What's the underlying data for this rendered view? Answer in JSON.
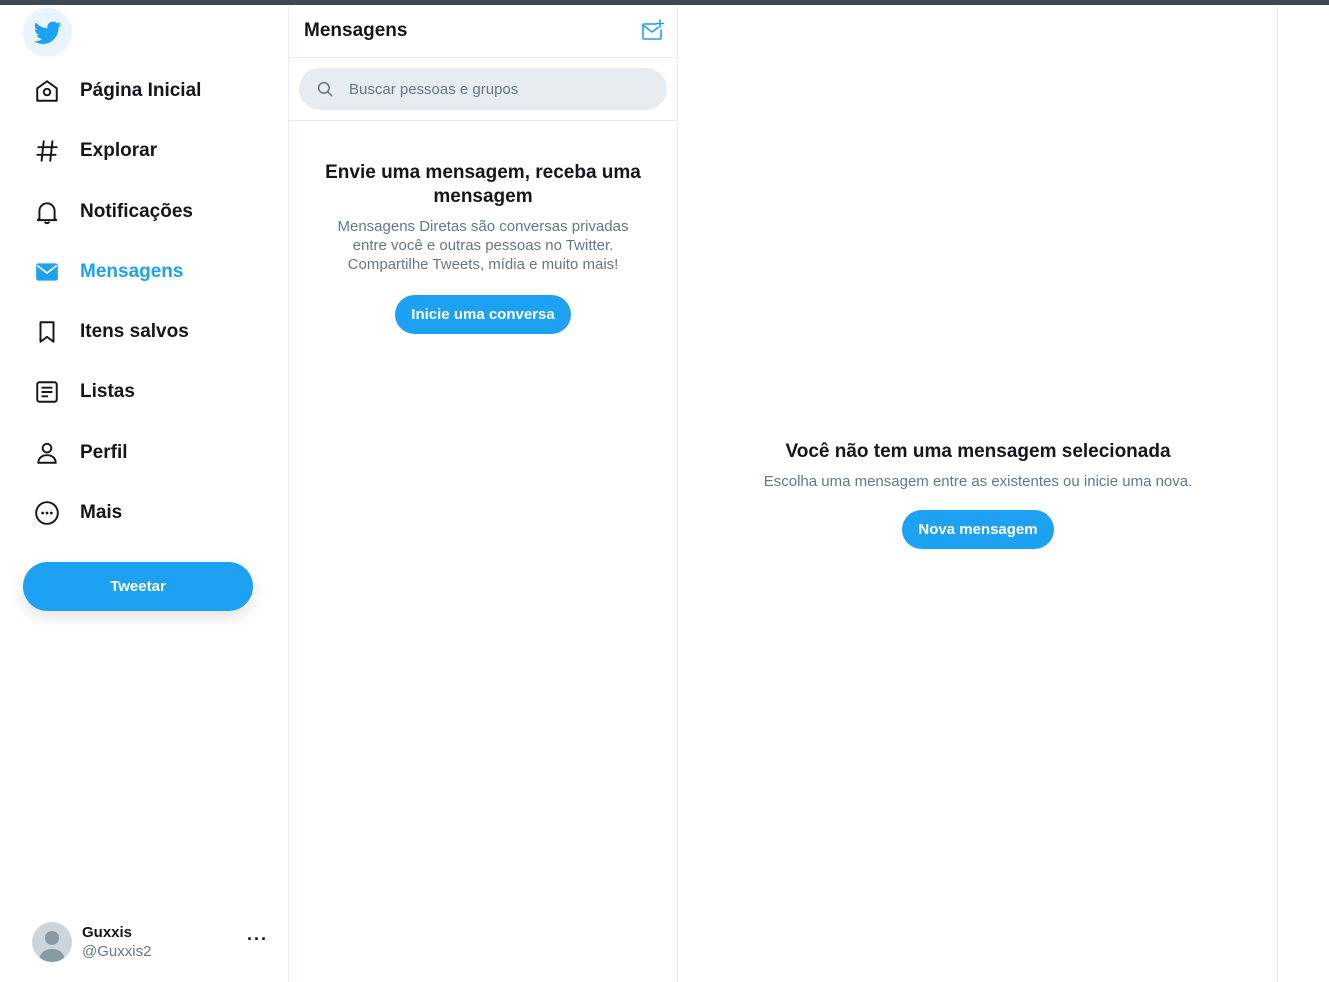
{
  "sidebar": {
    "logo_icon": "twitter-bird-icon",
    "items": [
      {
        "label": "Página Inicial",
        "icon": "home-icon"
      },
      {
        "label": "Explorar",
        "icon": "hashtag-icon"
      },
      {
        "label": "Notificações",
        "icon": "bell-icon"
      },
      {
        "label": "Mensagens",
        "icon": "envelope-icon",
        "active": true
      },
      {
        "label": "Itens salvos",
        "icon": "bookmark-icon"
      },
      {
        "label": "Listas",
        "icon": "list-icon"
      },
      {
        "label": "Perfil",
        "icon": "person-icon"
      },
      {
        "label": "Mais",
        "icon": "more-circle-icon"
      }
    ],
    "tweet_button": "Tweetar",
    "account": {
      "name": "Guxxis",
      "handle": "@Guxxis2",
      "more": "···"
    }
  },
  "messages": {
    "title": "Mensagens",
    "new_message_icon": "new-message-icon",
    "search_placeholder": "Buscar pessoas e grupos",
    "empty_title": "Envie uma mensagem, receba uma mensagem",
    "empty_text": "Mensagens Diretas são conversas privadas entre você e outras pessoas no Twitter. Compartilhe Tweets, mídia e muito mais!",
    "start_button": "Inicie uma conversa"
  },
  "detail": {
    "title": "Você não tem uma mensagem selecionada",
    "text": "Escolha uma mensagem entre as existentes ou inicie uma nova.",
    "button": "Nova mensagem"
  },
  "colors": {
    "accent": "#1da1f2",
    "text": "#14171a",
    "muted": "#657786",
    "border": "#e6ecf0"
  }
}
